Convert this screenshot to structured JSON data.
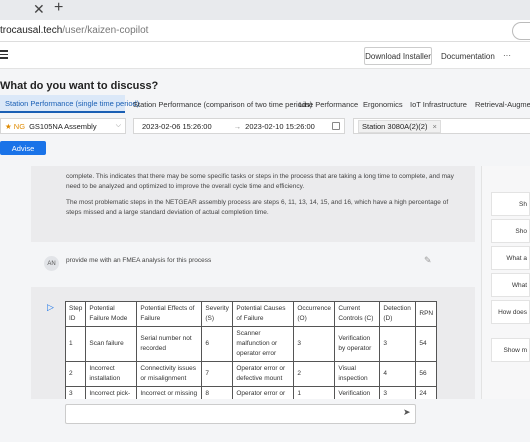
{
  "browser": {
    "tab_close": "✕",
    "tab_new": "+",
    "url_host": "trocausal.tech",
    "url_path": "/user/kaizen-copilot"
  },
  "appbar": {
    "download_installer": "Download Installer",
    "documentation": "Documentation",
    "more": "···"
  },
  "page_title": "What do you want to discuss?",
  "tabs": [
    {
      "label": "Station Performance (single time period)"
    },
    {
      "label": "Station Performance (comparison of two time periods)"
    },
    {
      "label": "Line Performance"
    },
    {
      "label": "Ergonomics"
    },
    {
      "label": "IoT Infrastructure"
    },
    {
      "label": "Retrieval-Augmented"
    }
  ],
  "filters": {
    "line_flag": "★ NG",
    "line_value": "GS105NA Assembly",
    "date_from": "2023-02-06 15:26:00",
    "arrow": "→",
    "date_to": "2023-02-10 15:26:00",
    "station_chip": "Station 3080A(2)(2)",
    "chip_close": "×"
  },
  "advise_label": "Advise",
  "assistant_text": {
    "p1": "complete. This indicates that there may be some specific tasks or steps in the process that are taking a long time to complete, and may need to be analyzed and optimized to improve the overall cycle time and efficiency.",
    "p2": "The most problematic steps in the NETGEAR assembly process are steps 6, 11, 13, 14, 15, and 16, which have a high percentage of steps missed and a large standard deviation of actual completion time."
  },
  "user_msg": {
    "avatar": "AN",
    "text": "provide me with an FMEA analysis for this process"
  },
  "fmea": {
    "headers": [
      "Step ID",
      "Potential Failure Mode",
      "Potential Effects of Failure",
      "Severity (S)",
      "Potential Causes of Failure",
      "Occurrence (O)",
      "Current Controls (C)",
      "Detection (D)",
      "RPN"
    ],
    "rows": [
      [
        "1",
        "Scan failure",
        "Serial number not recorded",
        "6",
        "Scanner malfunction or operator error",
        "3",
        "Verification by operator",
        "3",
        "54"
      ],
      [
        "2",
        "Incorrect installation",
        "Connectivity issues or misalignment",
        "7",
        "Operator error or defective mount",
        "2",
        "Visual inspection",
        "4",
        "56"
      ],
      [
        "3",
        "Incorrect pick-",
        "Incorrect or missing",
        "8",
        "Operator error or",
        "1",
        "Verification",
        "3",
        "24"
      ]
    ]
  },
  "side_suggestions": [
    "Sh",
    "Sho",
    "What a",
    "What",
    "How does",
    "Show m"
  ]
}
